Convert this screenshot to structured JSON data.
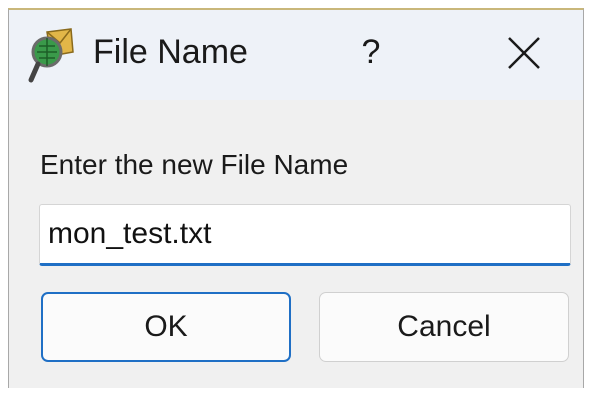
{
  "window": {
    "title": "File Name",
    "help_label": "?",
    "icon": "map-magnifier-icon",
    "close_icon": "close-icon"
  },
  "form": {
    "prompt": "Enter the new File Name",
    "filename_value": "mon_test.txt"
  },
  "buttons": {
    "ok_label": "OK",
    "cancel_label": "Cancel"
  },
  "colors": {
    "accent": "#1f6fc5",
    "titlebar_bg": "#eef2f8",
    "dialog_bg": "#f0f0f0"
  }
}
